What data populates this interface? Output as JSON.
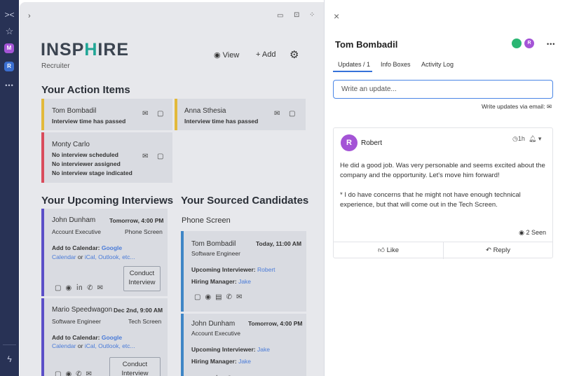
{
  "rail": {
    "collapse_icon": "collapse-icon",
    "star_icon": "star-icon",
    "avatar1": "M",
    "avatar2": "R",
    "more": "•••",
    "bolt_icon": "bolt-icon"
  },
  "app": {
    "logo_left": "INSP",
    "logo_h": "H",
    "logo_right": "IRE",
    "subtitle": "Recruiter",
    "view_label": "View",
    "add_label": "+ Add",
    "action_title": "Your Action Items",
    "action_items": [
      {
        "name": "Tom Bombadil",
        "lines": [
          "Interview time has passed"
        ]
      },
      {
        "name": "Anna Sthesia",
        "lines": [
          "Interview time has passed"
        ]
      },
      {
        "name": "Monty Carlo",
        "lines": [
          "No interview scheduled",
          "No interviewer assigned",
          "No interview stage indicated"
        ]
      }
    ],
    "upcoming_title": "Your Upcoming Interviews",
    "sourced_title": "Your Sourced Candidates",
    "calendar_label": "Add to Calendar:",
    "google": "Google",
    "calendar": "Calendar",
    "or": "or",
    "ical": "iCal, Outlook, etc...",
    "conduct1": "Conduct",
    "conduct2": "Interview",
    "interviews": [
      {
        "name": "John Dunham",
        "when": "Tomorrow, 4:00 PM",
        "role": "Account Executive",
        "stage": "Phone Screen"
      },
      {
        "name": "Mario Speedwagon",
        "when": "Dec 2nd, 9:00 AM",
        "role": "Software Engineer",
        "stage": "Tech Screen"
      }
    ],
    "sourced_stage": "Phone Screen",
    "upcoming_interviewer_label": "Upcoming Interviewer:",
    "hiring_manager_label": "Hiring Manager:",
    "sourced": [
      {
        "name": "Tom Bombadil",
        "when": "Today, 11:00 AM",
        "role": "Software Engineer",
        "interviewer": "Robert",
        "manager": "Jake"
      },
      {
        "name": "John Dunham",
        "when": "Tomorrow, 4:00 PM",
        "role": "Account Executive",
        "interviewer": "Jake",
        "manager": "Jake"
      }
    ],
    "colors": {
      "yellow": "#e2b93b",
      "red": "#d94c5c",
      "purple": "#5b4fc8",
      "blue": "#3f86c6",
      "teal": "#21a696"
    }
  },
  "panel": {
    "close": "×",
    "title": "Tom Bombadil",
    "tabs": [
      "Updates / 1",
      "Info Boxes",
      "Activity Log"
    ],
    "placeholder": "Write an update...",
    "email_label": "Write updates via email:",
    "post": {
      "avatar": "R",
      "author": "Robert",
      "time": "1h",
      "paragraph1": "He did a good job. Was very personable and seems excited about the company and the opportunity. Let's move him forward!",
      "paragraph2": "* I do have concerns that he might not have enough technical experience, but that will come out in the Tech Screen.",
      "seen": "2 Seen",
      "like": "Like",
      "reply": "Reply"
    },
    "more": "•••"
  }
}
